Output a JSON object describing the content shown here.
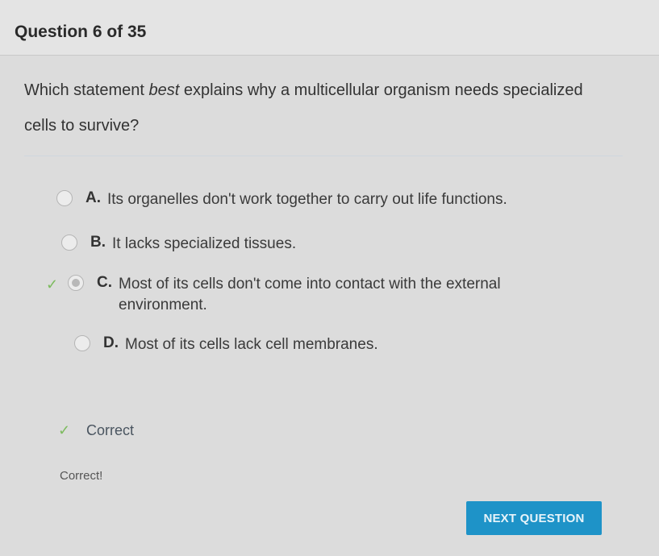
{
  "header": {
    "title": "Question 6 of 35"
  },
  "question": {
    "text_before": "Which statement ",
    "emphasis": "best",
    "text_after": " explains why a multicellular organism needs specialized cells to survive?"
  },
  "options": [
    {
      "letter": "A.",
      "text": "Its organelles don't work together to carry out life functions.",
      "selected": false
    },
    {
      "letter": "B.",
      "text": "It lacks specialized tissues.",
      "selected": false
    },
    {
      "letter": "C.",
      "text": "Most of its cells don't come into contact with the external environment.",
      "selected": true
    },
    {
      "letter": "D.",
      "text": "Most of its cells lack cell membranes.",
      "selected": false
    }
  ],
  "result": {
    "status_label": "Correct",
    "feedback": "Correct!"
  },
  "footer": {
    "next_label": "NEXT QUESTION"
  },
  "colors": {
    "accent": "#1e93c8",
    "correct": "#7dbb5f"
  },
  "icons": {
    "correct": "check-icon"
  }
}
